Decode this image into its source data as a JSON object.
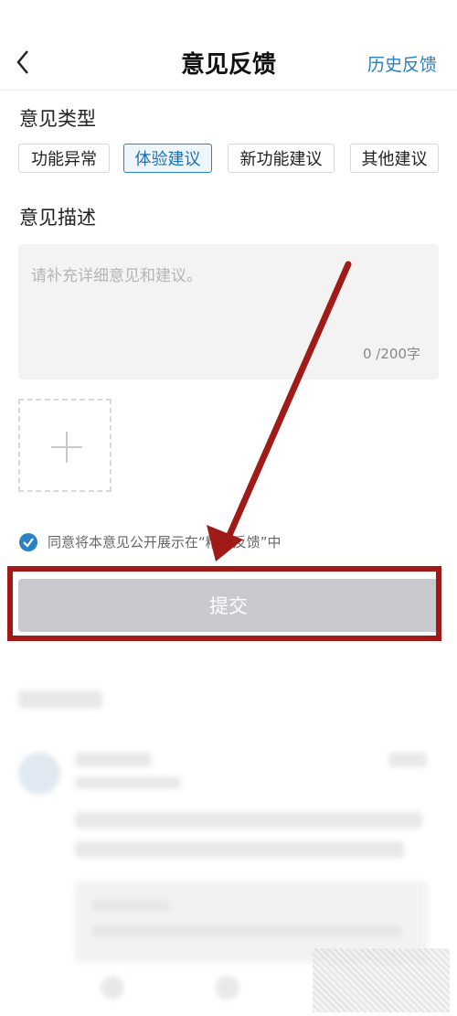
{
  "header": {
    "title": "意见反馈",
    "history_label": "历史反馈"
  },
  "feedback_type": {
    "label": "意见类型",
    "options": [
      "功能异常",
      "体验建议",
      "新功能建议",
      "其他建议"
    ],
    "selected": "体验建议"
  },
  "description": {
    "label": "意见描述",
    "placeholder": "请补充详细意见和建议。",
    "char_count": "0 /200字"
  },
  "agreement": {
    "text": "同意将本意见公开展示在“精选反馈”中",
    "checked": true
  },
  "submit": {
    "label": "提交"
  },
  "colors": {
    "accent": "#2a82c6",
    "highlight": "#a01a18",
    "submit_disabled": "#c9c9d0"
  }
}
